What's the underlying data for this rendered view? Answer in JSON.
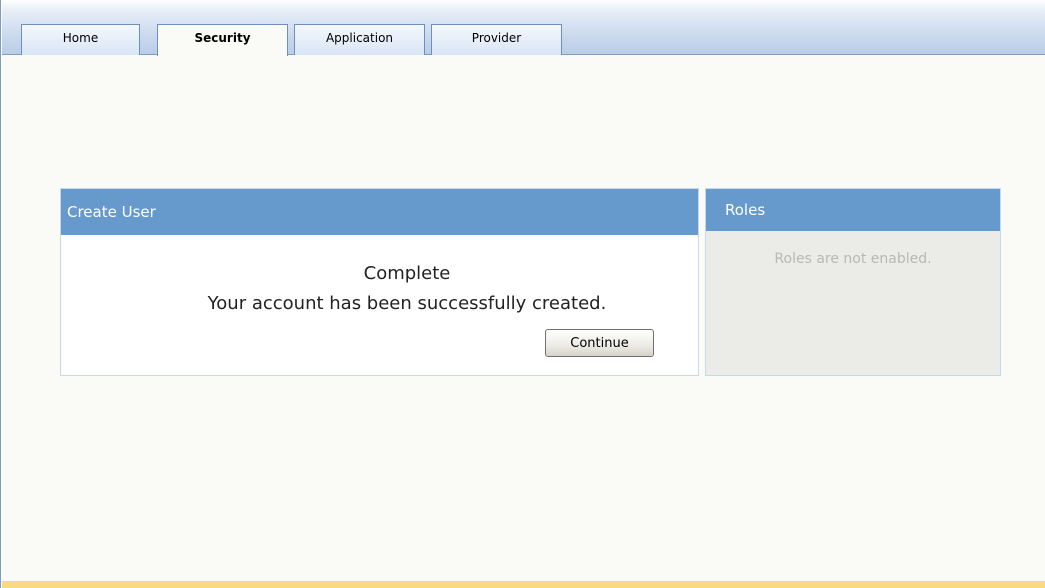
{
  "tabs": [
    {
      "label": "Home",
      "active": false
    },
    {
      "label": "Security",
      "active": true
    },
    {
      "label": "Application",
      "active": false
    },
    {
      "label": "Provider",
      "active": false
    }
  ],
  "create_user": {
    "title": "Create User",
    "complete_heading": "Complete",
    "message": "Your account has been successfully created.",
    "continue_label": "Continue"
  },
  "roles": {
    "title": "Roles",
    "message": "Roles are not enabled."
  },
  "colors": {
    "panel_header": "#6699cc",
    "footer_bar": "#f8db7e",
    "roles_background": "#ebebe7",
    "page_background": "#fafbf7"
  }
}
